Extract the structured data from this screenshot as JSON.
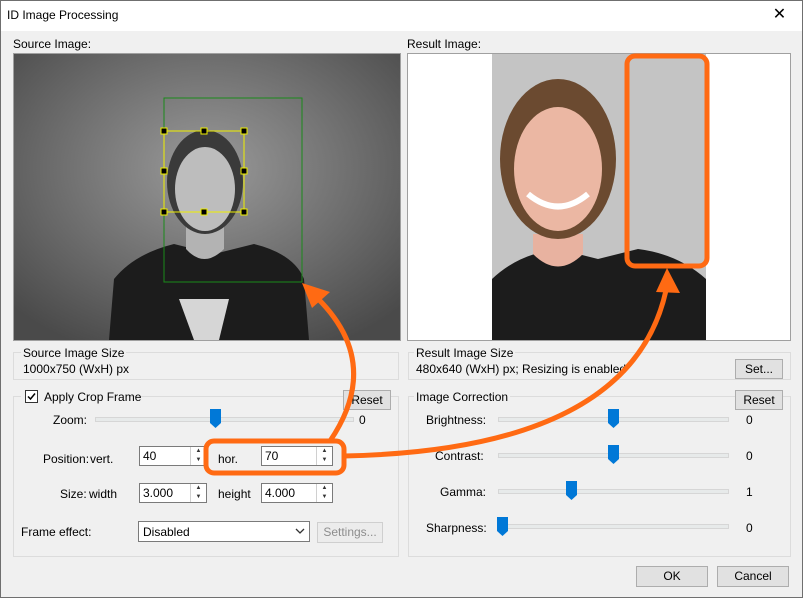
{
  "window": {
    "title": "ID Image Processing",
    "close_glyph": "✕"
  },
  "source": {
    "label": "Source Image:",
    "size_title": "Source Image Size",
    "size_value": "1000x750 (WxH) px"
  },
  "result": {
    "label": "Result Image:",
    "size_title": "Result Image Size",
    "size_value": "480x640 (WxH) px; Resizing is enabled",
    "set_button": "Set..."
  },
  "crop": {
    "checkbox_label": "Apply Crop Frame",
    "checked": true,
    "reset_button": "Reset",
    "zoom_label": "Zoom:",
    "zoom_value": "0",
    "position_label": "Position:",
    "vert_label": "vert.",
    "vert_value": "40",
    "hor_label": "hor.",
    "hor_value": "70",
    "size_label": "Size:",
    "width_label": "width",
    "width_value": "3.000",
    "height_label": "height",
    "height_value": "4.000",
    "frame_effect_label": "Frame effect:",
    "frame_effect_value": "Disabled",
    "settings_button": "Settings..."
  },
  "correction": {
    "title": "Image Correction",
    "reset_button": "Reset",
    "brightness_label": "Brightness:",
    "brightness_value": "0",
    "contrast_label": "Contrast:",
    "contrast_value": "0",
    "gamma_label": "Gamma:",
    "gamma_value": "1",
    "sharpness_label": "Sharpness:",
    "sharpness_value": "0"
  },
  "footer": {
    "ok": "OK",
    "cancel": "Cancel"
  },
  "colors": {
    "accent": "#0078d7",
    "annotation": "#ff6a13",
    "crop_frame": "#1a8a1a",
    "face_box": "#f0f000"
  }
}
